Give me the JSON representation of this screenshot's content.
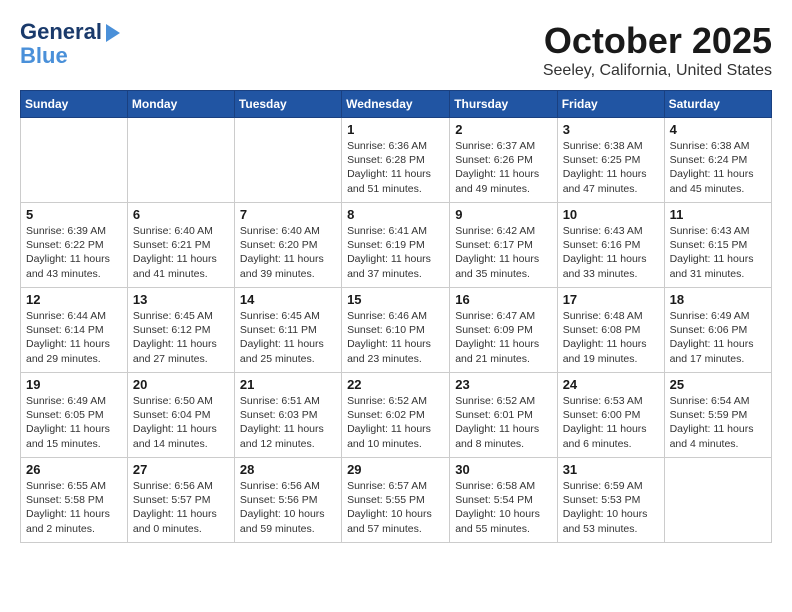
{
  "logo": {
    "line1": "General",
    "line2": "Blue",
    "arrow": "▶"
  },
  "title": "October 2025",
  "subtitle": "Seeley, California, United States",
  "days_of_week": [
    "Sunday",
    "Monday",
    "Tuesday",
    "Wednesday",
    "Thursday",
    "Friday",
    "Saturday"
  ],
  "weeks": [
    [
      {
        "day": "",
        "info": ""
      },
      {
        "day": "",
        "info": ""
      },
      {
        "day": "",
        "info": ""
      },
      {
        "day": "1",
        "info": "Sunrise: 6:36 AM\nSunset: 6:28 PM\nDaylight: 11 hours\nand 51 minutes."
      },
      {
        "day": "2",
        "info": "Sunrise: 6:37 AM\nSunset: 6:26 PM\nDaylight: 11 hours\nand 49 minutes."
      },
      {
        "day": "3",
        "info": "Sunrise: 6:38 AM\nSunset: 6:25 PM\nDaylight: 11 hours\nand 47 minutes."
      },
      {
        "day": "4",
        "info": "Sunrise: 6:38 AM\nSunset: 6:24 PM\nDaylight: 11 hours\nand 45 minutes."
      }
    ],
    [
      {
        "day": "5",
        "info": "Sunrise: 6:39 AM\nSunset: 6:22 PM\nDaylight: 11 hours\nand 43 minutes."
      },
      {
        "day": "6",
        "info": "Sunrise: 6:40 AM\nSunset: 6:21 PM\nDaylight: 11 hours\nand 41 minutes."
      },
      {
        "day": "7",
        "info": "Sunrise: 6:40 AM\nSunset: 6:20 PM\nDaylight: 11 hours\nand 39 minutes."
      },
      {
        "day": "8",
        "info": "Sunrise: 6:41 AM\nSunset: 6:19 PM\nDaylight: 11 hours\nand 37 minutes."
      },
      {
        "day": "9",
        "info": "Sunrise: 6:42 AM\nSunset: 6:17 PM\nDaylight: 11 hours\nand 35 minutes."
      },
      {
        "day": "10",
        "info": "Sunrise: 6:43 AM\nSunset: 6:16 PM\nDaylight: 11 hours\nand 33 minutes."
      },
      {
        "day": "11",
        "info": "Sunrise: 6:43 AM\nSunset: 6:15 PM\nDaylight: 11 hours\nand 31 minutes."
      }
    ],
    [
      {
        "day": "12",
        "info": "Sunrise: 6:44 AM\nSunset: 6:14 PM\nDaylight: 11 hours\nand 29 minutes."
      },
      {
        "day": "13",
        "info": "Sunrise: 6:45 AM\nSunset: 6:12 PM\nDaylight: 11 hours\nand 27 minutes."
      },
      {
        "day": "14",
        "info": "Sunrise: 6:45 AM\nSunset: 6:11 PM\nDaylight: 11 hours\nand 25 minutes."
      },
      {
        "day": "15",
        "info": "Sunrise: 6:46 AM\nSunset: 6:10 PM\nDaylight: 11 hours\nand 23 minutes."
      },
      {
        "day": "16",
        "info": "Sunrise: 6:47 AM\nSunset: 6:09 PM\nDaylight: 11 hours\nand 21 minutes."
      },
      {
        "day": "17",
        "info": "Sunrise: 6:48 AM\nSunset: 6:08 PM\nDaylight: 11 hours\nand 19 minutes."
      },
      {
        "day": "18",
        "info": "Sunrise: 6:49 AM\nSunset: 6:06 PM\nDaylight: 11 hours\nand 17 minutes."
      }
    ],
    [
      {
        "day": "19",
        "info": "Sunrise: 6:49 AM\nSunset: 6:05 PM\nDaylight: 11 hours\nand 15 minutes."
      },
      {
        "day": "20",
        "info": "Sunrise: 6:50 AM\nSunset: 6:04 PM\nDaylight: 11 hours\nand 14 minutes."
      },
      {
        "day": "21",
        "info": "Sunrise: 6:51 AM\nSunset: 6:03 PM\nDaylight: 11 hours\nand 12 minutes."
      },
      {
        "day": "22",
        "info": "Sunrise: 6:52 AM\nSunset: 6:02 PM\nDaylight: 11 hours\nand 10 minutes."
      },
      {
        "day": "23",
        "info": "Sunrise: 6:52 AM\nSunset: 6:01 PM\nDaylight: 11 hours\nand 8 minutes."
      },
      {
        "day": "24",
        "info": "Sunrise: 6:53 AM\nSunset: 6:00 PM\nDaylight: 11 hours\nand 6 minutes."
      },
      {
        "day": "25",
        "info": "Sunrise: 6:54 AM\nSunset: 5:59 PM\nDaylight: 11 hours\nand 4 minutes."
      }
    ],
    [
      {
        "day": "26",
        "info": "Sunrise: 6:55 AM\nSunset: 5:58 PM\nDaylight: 11 hours\nand 2 minutes."
      },
      {
        "day": "27",
        "info": "Sunrise: 6:56 AM\nSunset: 5:57 PM\nDaylight: 11 hours\nand 0 minutes."
      },
      {
        "day": "28",
        "info": "Sunrise: 6:56 AM\nSunset: 5:56 PM\nDaylight: 10 hours\nand 59 minutes."
      },
      {
        "day": "29",
        "info": "Sunrise: 6:57 AM\nSunset: 5:55 PM\nDaylight: 10 hours\nand 57 minutes."
      },
      {
        "day": "30",
        "info": "Sunrise: 6:58 AM\nSunset: 5:54 PM\nDaylight: 10 hours\nand 55 minutes."
      },
      {
        "day": "31",
        "info": "Sunrise: 6:59 AM\nSunset: 5:53 PM\nDaylight: 10 hours\nand 53 minutes."
      },
      {
        "day": "",
        "info": ""
      }
    ]
  ]
}
